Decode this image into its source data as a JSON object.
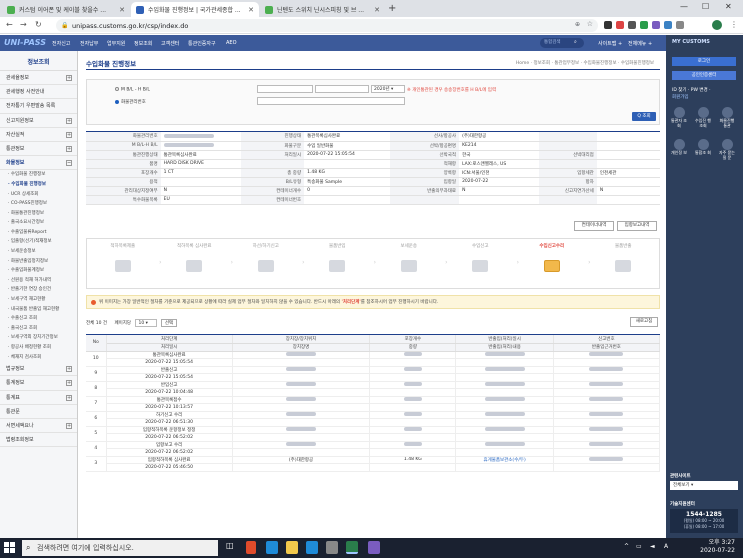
{
  "browser": {
    "tabs": [
      {
        "label": "커스텀 이어폰 및 케이블 찾을수 ...",
        "color": "#4caf50"
      },
      {
        "label": "수입화물 진행정보 | 국가관세종합 ...",
        "color": "#2e5fb5"
      },
      {
        "label": "닌텐도 스위치 닌시스피칭 및 브 ...",
        "color": "#4caf50"
      }
    ],
    "url": "unipass.customs.go.kr/csp/index.do"
  },
  "topnav": {
    "logo": "UNI-PASS",
    "items": [
      "전자신고",
      "전자납부",
      "업무지원",
      "정보조회",
      "고객센터",
      "통관인증자구",
      "AEO"
    ],
    "search_placeholder": "통합검색",
    "right_links": [
      "사이트맵 +",
      "전체메뉴 +"
    ]
  },
  "sidebar": {
    "title": "정보조회",
    "items": [
      {
        "label": "관세율정보",
        "plus": true
      },
      {
        "label": "관세행정 사전안내",
        "plus": false
      },
      {
        "label": "전자통기 우편발송 목록",
        "plus": false
      },
      {
        "label": "신고지원정보",
        "plus": true
      },
      {
        "label": "자산실적",
        "plus": true
      },
      {
        "label": "통관정보",
        "plus": true
      },
      {
        "label": "화물정보",
        "plus": true
      }
    ],
    "subitems": [
      "· 수입화물 진행정보",
      "· 수입화물 진행정보",
      "· UCR 상세조회",
      "· CO-PASS진행정보",
      "· 화물통관진행정보",
      "· 출국소요시간정보",
      "· 수출입물류Report",
      "· 입출항(선기)적재정보",
      "· 보세운송정보",
      "· 화물반출입정지정보",
      "· 수출입화물계정보",
      "· 선원용 적재 허가내역",
      "· 반출기한 연장 승인건",
      "· 보세구역 재고현황",
      "· 내국물품 반출입 재고현황",
      "· 수출신고 조회",
      "· 출국신고 조회",
      "· 보세구역외 장치기간정보",
      "· 항공사 배정현황 조회",
      "· 체재지 검사조회"
    ],
    "more_items": [
      "법규정보",
      "통계정보",
      "통계표",
      "통관문",
      "서면세액요나",
      "법령조회정보"
    ]
  },
  "main": {
    "page_title": "수입화물 진행정보",
    "breadcrumb": "Home · 정보조회 · 통관업무정보 · 수입화물진행정보 · 수입화물진행정보",
    "search": {
      "radio1": "M B/L - H B/L",
      "radio2": "화물관리번호",
      "year": "2020년",
      "warning": "※ 개인통관된 경우 송송장번호를 H B/L에 입력",
      "search_btn": "Q 조회"
    },
    "info_rows": [
      [
        "화물관리번호",
        "",
        "진행상태",
        "통관목록심사완료",
        "선사/항공사",
        "(주)대한항공",
        "",
        ""
      ],
      [
        "M B/L-H B/L",
        "",
        "화물구분",
        "수입 일반화물",
        "선박/항공편명",
        "KE214",
        "",
        ""
      ],
      [
        "통관진행상태",
        "통관목록심사완료",
        "처리일시",
        "2020-07-22 15:05:54",
        "선박국적",
        "한국",
        "선박대리점",
        ""
      ],
      [
        "품명",
        "HARD DISK DRIVE",
        "",
        "",
        "적재항",
        "LAX:로스앤젤레스, US",
        "",
        ""
      ],
      [
        "포장개수",
        "1 CT",
        "총 중량",
        "1.48 KG",
        "양륙항",
        "ICN:서울/인천",
        "입항세관",
        "인천세관"
      ],
      [
        "용적",
        "",
        "B/L유형",
        "특송화물 Sample",
        "입항일",
        "2020-07-22",
        "항차",
        ""
      ],
      [
        "관리대상지정여부",
        "N",
        "컨테이너개수",
        "0",
        "반출의무과태료",
        "N",
        "신고지연가산세",
        "N"
      ],
      [
        "특수화물목록",
        "EU",
        "컨테이너번호",
        "",
        "",
        "",
        "",
        ""
      ]
    ],
    "buttons": {
      "container": "컨테이너내역",
      "entry": "입항보고내역"
    },
    "steps": [
      {
        "label": "적하목록제출",
        "active": false
      },
      {
        "label": "적하목록 심사완료",
        "active": false
      },
      {
        "label": "하선/하기신고",
        "active": false
      },
      {
        "label": "물품반입",
        "active": false
      },
      {
        "label": "보세운송",
        "active": false
      },
      {
        "label": "수입신고",
        "active": false
      },
      {
        "label": "수입신고수리",
        "active": true
      },
      {
        "label": "물품반출",
        "active": false
      }
    ],
    "notice": {
      "text": "위 이미지는 가장 일반적인 절차를 기준으로 제공되므로 상황에 따라 실제 업무 절차와 일치하지 않을 수 있습니다. 반드시 아래의 ",
      "red": "'처리단계'",
      "text2": "를 참조하시어 업무 진행하시기 바랍니다."
    },
    "list": {
      "total": "전체 10 건",
      "page_count_label": "페이지당",
      "page_count": "10",
      "select_btn": "선택",
      "refresh_btn": "새로고침"
    },
    "table_headers": {
      "col_no": "No",
      "top": [
        "처리단계",
        "장치장/장치위치",
        "포장개수",
        "반출입(처리)일시",
        "신고번호"
      ],
      "bottom": [
        "처리일시",
        "장치장명",
        "중량",
        "반출입(처리)내용",
        "반출입근거번호"
      ]
    },
    "rows": [
      {
        "no": "10",
        "step": "통관목록심사완료",
        "time": "2020-07-22 15:05:54",
        "place": "",
        "pkg": "",
        "wgt": "",
        "io": "",
        "io2": ""
      },
      {
        "no": "9",
        "step": "반출신고",
        "time": "2020-07-22 15:05:54",
        "place": "",
        "pkg": "",
        "wgt": "",
        "io": "",
        "io2": ""
      },
      {
        "no": "8",
        "step": "반입신고",
        "time": "2020-07-22 10:04:48",
        "place": "",
        "pkg": "",
        "wgt": "",
        "io": "",
        "io2": ""
      },
      {
        "no": "7",
        "step": "통관목록접수",
        "time": "2020-07-22 10:13:57",
        "place": "",
        "pkg": "",
        "wgt": "",
        "io": "",
        "io2": ""
      },
      {
        "no": "6",
        "step": "하기신고 수리",
        "time": "2020-07-22 06:51:30",
        "place": "",
        "pkg": "",
        "wgt": "",
        "io": "",
        "io2": ""
      },
      {
        "no": "5",
        "step": "입항적하목록 운항정보 정정",
        "time": "2020-07-22 06:52:02",
        "place": "",
        "pkg": "",
        "wgt": "",
        "io": "",
        "io2": ""
      },
      {
        "no": "4",
        "step": "입항보고 수리",
        "time": "2020-07-22 06:52:02",
        "place": "",
        "pkg": "",
        "wgt": "",
        "io": "",
        "io2": ""
      },
      {
        "no": "3",
        "step": "입항적하목록 심사완료",
        "time": "2020-07-22 05:46:50",
        "place": "(주)대한항공",
        "pkg": "1.48 KG",
        "wgt": "",
        "io": "휴게물품보관소(수/두)",
        "io2": ""
      }
    ]
  },
  "right_panel": {
    "title": "MY CUSTOMS",
    "login_btn": "로그인",
    "cert_btn": "공인인증센터",
    "id_find": "ID 찾기 · PW 변경 ·",
    "join": "회원가입",
    "icons": [
      "통관자 조회",
      "수입진 행조회",
      "화물진행 통관",
      "개인정 보",
      "통합조 회",
      "자주 묻는질 문"
    ],
    "related_title": "관련사이트",
    "related_select": "전체보기",
    "support_title": "기술지원센터",
    "phone": "1544-1285",
    "hours1": "(평일) 08:00 ~ 20:00",
    "hours2": "(휴일) 08:00 ~ 17:00"
  },
  "taskbar": {
    "search_placeholder": "검색하려면 여기에 입력하십시오.",
    "time": "오후 3:27",
    "date": "2020-07-22",
    "lang": "A"
  }
}
